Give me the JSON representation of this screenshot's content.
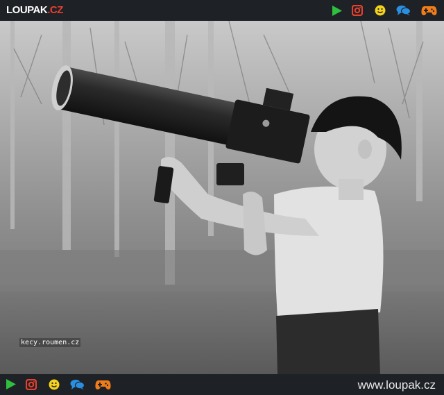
{
  "header": {
    "logo_main": "LOUPAK",
    "logo_tld": ".CZ",
    "icons": [
      "play-icon",
      "instagram-icon",
      "smiley-icon",
      "chat-icon",
      "gamepad-icon"
    ]
  },
  "photo": {
    "watermark": "kecy.roumen.cz"
  },
  "footer": {
    "icons": [
      "play-icon",
      "instagram-icon",
      "smiley-icon",
      "chat-icon",
      "gamepad-icon"
    ],
    "site_url": "www.loupak.cz"
  },
  "colors": {
    "bar_bg": "#1e2126",
    "play": "#2fbf3f",
    "instagram": "#e8402e",
    "smiley": "#f5d21b",
    "chat": "#2a8fe0",
    "gamepad": "#f07d1a",
    "logo_accent": "#e8402e"
  }
}
